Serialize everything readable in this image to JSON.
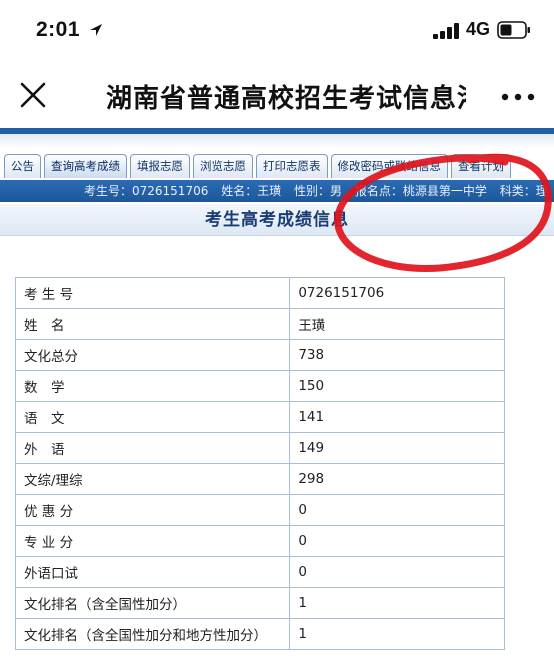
{
  "status_bar": {
    "time": "2:01",
    "network": "4G"
  },
  "nav": {
    "title": "湖南省普通高校招生考试信息港"
  },
  "tabs": [
    {
      "label": "公告"
    },
    {
      "label": "查询高考成绩"
    },
    {
      "label": "填报志愿"
    },
    {
      "label": "浏览志愿"
    },
    {
      "label": "打印志愿表"
    },
    {
      "label": "修改密码或联络信息"
    },
    {
      "label": "查看计划"
    }
  ],
  "candidate_info": {
    "exam_no": "考生号：0726151706",
    "name": "姓名：王璜",
    "gender": "性别：男",
    "site": "报名点：桃源县第一中学",
    "category": "科类：理"
  },
  "section": {
    "title": "考生高考成绩信息"
  },
  "score_table": {
    "rows": [
      {
        "label": "考 生 号",
        "value": "0726151706"
      },
      {
        "label": "姓　名",
        "value": "王璜"
      },
      {
        "label": "文化总分",
        "value": "738"
      },
      {
        "label": "数　学",
        "value": "150"
      },
      {
        "label": "语　文",
        "value": "141"
      },
      {
        "label": "外　语",
        "value": "149"
      },
      {
        "label": "文综/理综",
        "value": "298"
      },
      {
        "label": "优 惠 分",
        "value": "0"
      },
      {
        "label": "专 业 分",
        "value": "0"
      },
      {
        "label": "外语口试",
        "value": "0"
      },
      {
        "label": "文化排名（含全国性加分）",
        "value": "1"
      },
      {
        "label": "文化排名（含全国性加分和地方性加分）",
        "value": "1"
      }
    ]
  },
  "colors": {
    "brand_blue": "#1f5fa6",
    "annotation_red": "#e0141b"
  },
  "icons": {
    "location": "location-arrow-icon",
    "signal": "signal-bars-icon",
    "battery": "battery-icon",
    "close": "close-icon",
    "more": "more-dots-icon"
  }
}
